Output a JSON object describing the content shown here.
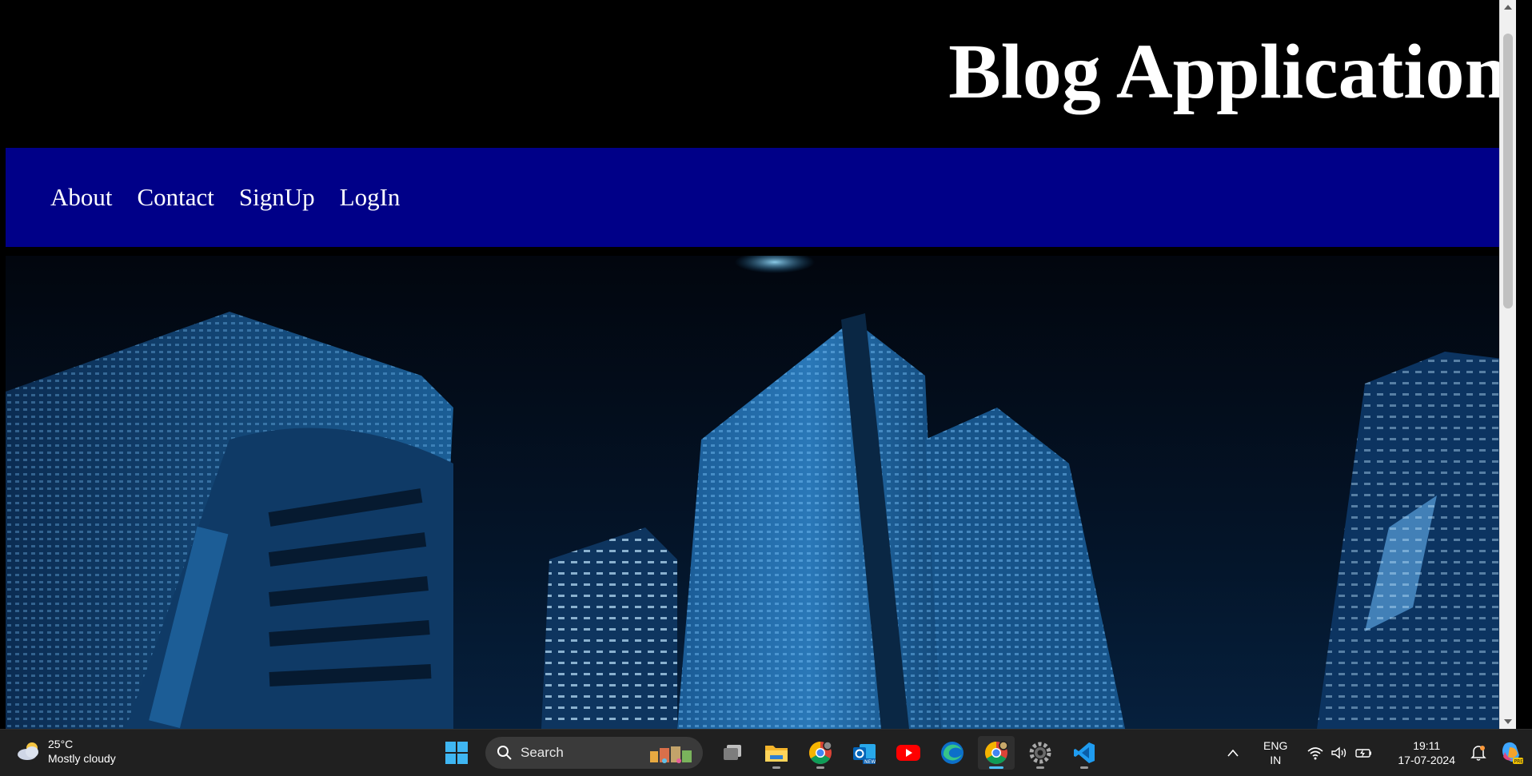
{
  "site": {
    "title": "Blog Application"
  },
  "nav": {
    "items": [
      {
        "label": "About"
      },
      {
        "label": "Contact"
      },
      {
        "label": "SignUp"
      },
      {
        "label": "LogIn"
      }
    ]
  },
  "taskbar": {
    "weather": {
      "temperature": "25°C",
      "condition": "Mostly cloudy",
      "icon": "cloud-icon"
    },
    "search": {
      "placeholder": "Search"
    },
    "apps": [
      {
        "name": "start-icon"
      },
      {
        "name": "task-view-icon"
      },
      {
        "name": "file-explorer-icon"
      },
      {
        "name": "chrome-icon"
      },
      {
        "name": "outlook-icon"
      },
      {
        "name": "youtube-icon"
      },
      {
        "name": "edge-icon"
      },
      {
        "name": "chrome-active-icon"
      },
      {
        "name": "settings-icon"
      },
      {
        "name": "vscode-icon"
      }
    ],
    "language": {
      "line1": "ENG",
      "line2": "IN"
    },
    "clock": {
      "time": "19:11",
      "date": "17-07-2024"
    }
  },
  "colors": {
    "nav_background": "#000088",
    "page_background": "#000000",
    "taskbar_background": "#202020",
    "accent": "#4cc2ff"
  }
}
